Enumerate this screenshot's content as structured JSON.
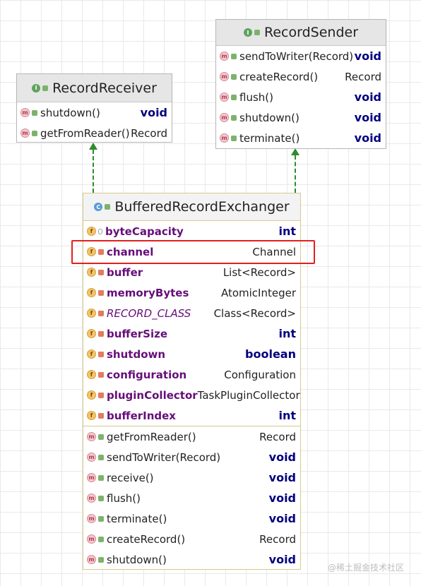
{
  "diagram": {
    "receiver": {
      "title": "RecordReceiver",
      "methods": [
        {
          "name": "shutdown()",
          "type": "void",
          "kw": true
        },
        {
          "name": "getFromReader()",
          "type": "Record",
          "kw": false
        }
      ]
    },
    "sender": {
      "title": "RecordSender",
      "methods": [
        {
          "name": "sendToWriter(Record)",
          "type": "void",
          "kw": true
        },
        {
          "name": "createRecord()",
          "type": "Record",
          "kw": false
        },
        {
          "name": "flush()",
          "type": "void",
          "kw": true
        },
        {
          "name": "shutdown()",
          "type": "void",
          "kw": true
        },
        {
          "name": "terminate()",
          "type": "void",
          "kw": true
        }
      ]
    },
    "exchanger": {
      "title": "BufferedRecordExchanger",
      "fields": [
        {
          "name": "byteCapacity",
          "type": "int",
          "kw": true
        },
        {
          "name": "channel",
          "type": "Channel",
          "kw": false
        },
        {
          "name": "buffer",
          "type": "List<Record>",
          "kw": false
        },
        {
          "name": "memoryBytes",
          "type": "AtomicInteger",
          "kw": false
        },
        {
          "name": "RECORD_CLASS",
          "type": "Class<Record>",
          "kw": false
        },
        {
          "name": "bufferSize",
          "type": "int",
          "kw": true
        },
        {
          "name": "shutdown",
          "type": "boolean",
          "kw": true
        },
        {
          "name": "configuration",
          "type": "Configuration",
          "kw": false
        },
        {
          "name": "pluginCollector",
          "type": "TaskPluginCollector",
          "kw": false
        },
        {
          "name": "bufferIndex",
          "type": "int",
          "kw": true
        }
      ],
      "methods": [
        {
          "name": "getFromReader()",
          "type": "Record",
          "kw": false
        },
        {
          "name": "sendToWriter(Record)",
          "type": "void",
          "kw": true
        },
        {
          "name": "receive()",
          "type": "void",
          "kw": true
        },
        {
          "name": "flush()",
          "type": "void",
          "kw": true
        },
        {
          "name": "terminate()",
          "type": "void",
          "kw": true
        },
        {
          "name": "createRecord()",
          "type": "Record",
          "kw": false
        },
        {
          "name": "shutdown()",
          "type": "void",
          "kw": true
        }
      ]
    }
  },
  "badges": {
    "interface": "I",
    "class": "C",
    "method": "m",
    "field": "f"
  },
  "colors": {
    "grid": "#e9e9e9",
    "arrow": "#2e8b2e",
    "highlight": "#e02020",
    "keyword": "#000080",
    "field": "#660e7a"
  },
  "watermark": "@稀土掘金技术社区"
}
